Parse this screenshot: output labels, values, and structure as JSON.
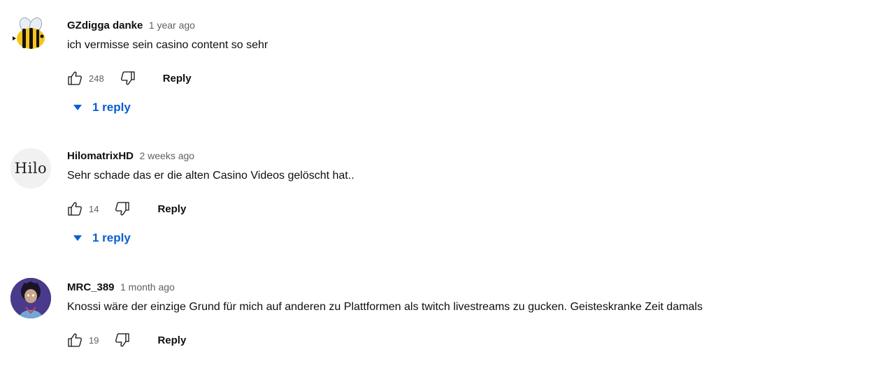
{
  "comments": [
    {
      "author": "GZdigga danke",
      "time": "1 year ago",
      "text": "ich vermisse sein casino content so sehr",
      "likes": "248",
      "reply_label": "Reply",
      "replies_label": "1 reply",
      "avatar_icon": "bee-icon"
    },
    {
      "author": "HilomatrixHD",
      "time": "2 weeks ago",
      "text": "Sehr schade das er die alten Casino Videos gelöscht hat..",
      "likes": "14",
      "reply_label": "Reply",
      "replies_label": "1 reply",
      "avatar_text": "Hilo"
    },
    {
      "author": "MRC_389",
      "time": "1 month ago",
      "text": "Knossi wäre der einzige Grund für mich auf anderen zu Plattformen als twitch livestreams zu gucken. Geisteskranke Zeit damals",
      "likes": "19",
      "reply_label": "Reply",
      "avatar_icon": "character-avatar-icon"
    }
  ],
  "colors": {
    "link_blue": "#065fd4",
    "meta_gray": "#606060",
    "text": "#0f0f0f"
  }
}
